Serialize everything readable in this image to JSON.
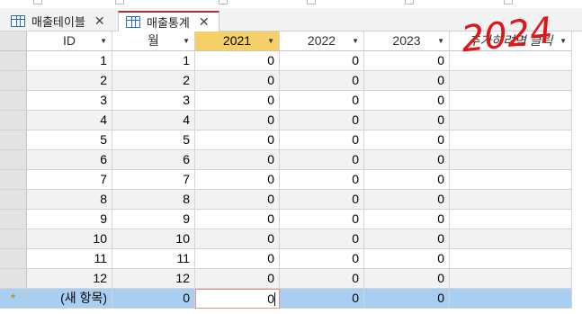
{
  "tabs": [
    {
      "label": "매출테이블",
      "active": false
    },
    {
      "label": "매출통계",
      "active": true
    }
  ],
  "columns": [
    "ID",
    "월",
    "2021",
    "2022",
    "2023",
    "추가하려면 클릭"
  ],
  "selected_column": "2021",
  "rows": [
    [
      1,
      1,
      0,
      0,
      0
    ],
    [
      2,
      2,
      0,
      0,
      0
    ],
    [
      3,
      3,
      0,
      0,
      0
    ],
    [
      4,
      4,
      0,
      0,
      0
    ],
    [
      5,
      5,
      0,
      0,
      0
    ],
    [
      6,
      6,
      0,
      0,
      0
    ],
    [
      7,
      7,
      0,
      0,
      0
    ],
    [
      8,
      8,
      0,
      0,
      0
    ],
    [
      9,
      9,
      0,
      0,
      0
    ],
    [
      10,
      10,
      0,
      0,
      0
    ],
    [
      11,
      11,
      0,
      0,
      0
    ],
    [
      12,
      12,
      0,
      0,
      0
    ]
  ],
  "new_row": {
    "marker": "*",
    "id": "(새 항목)",
    "month": "0",
    "y2021": "0",
    "y2022": "0",
    "y2023": "0"
  },
  "annotation": "2024",
  "colors": {
    "accent_tab": "#a4373a",
    "selected_header": "#f5cf67",
    "new_row": "#a8cff2",
    "annotation": "#e0161a"
  }
}
